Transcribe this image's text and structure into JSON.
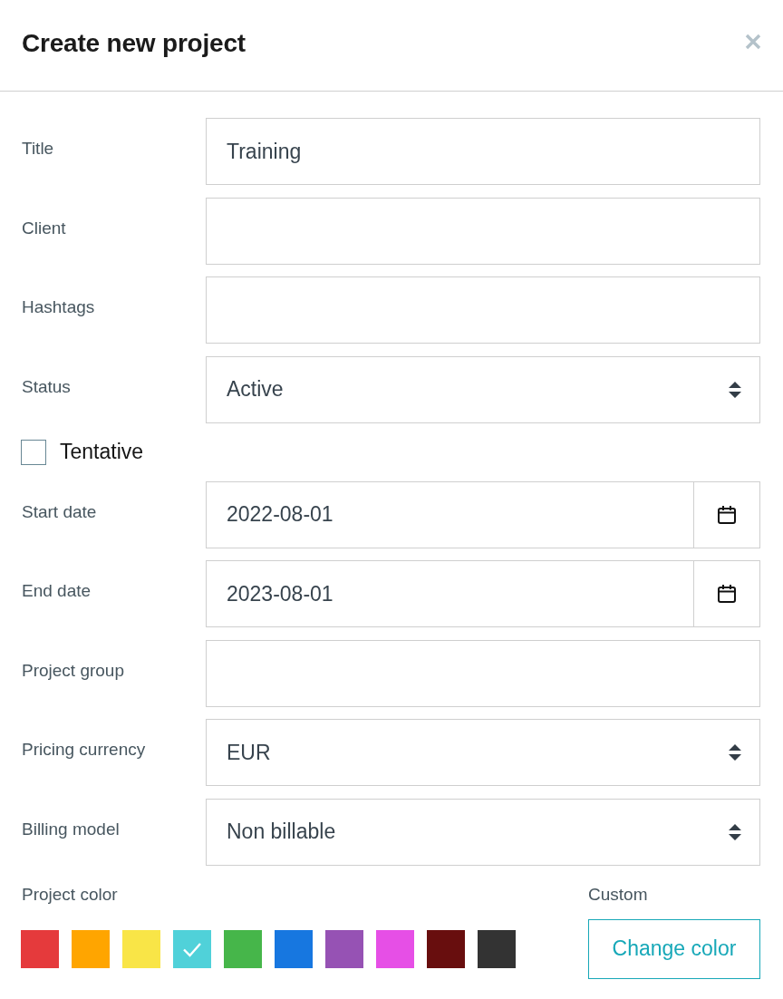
{
  "dialog": {
    "title": "Create new project"
  },
  "fields": [
    {
      "kind": "text",
      "label": "Title",
      "value": "Training"
    },
    {
      "kind": "text",
      "label": "Client"
    },
    {
      "kind": "text",
      "label": "Hashtags"
    },
    {
      "kind": "select",
      "label": "Status",
      "value": "Active"
    },
    {
      "kind": "checkbox",
      "label": "Tentative",
      "checked": false
    },
    {
      "kind": "date",
      "label": "Start date",
      "value": "2022-08-01"
    },
    {
      "kind": "date",
      "label": "End date",
      "value": "2023-08-01"
    },
    {
      "kind": "text",
      "label": "Project group"
    },
    {
      "kind": "select",
      "label": "Pricing currency",
      "value": "EUR"
    },
    {
      "kind": "select",
      "label": "Billing model",
      "value": "Non billable"
    }
  ],
  "project_color": {
    "label": "Project color",
    "swatches": [
      {
        "color": "#e53a3c",
        "selected": false
      },
      {
        "color": "#ffa500",
        "selected": false
      },
      {
        "color": "#f9e547",
        "selected": false
      },
      {
        "color": "#50d1d9",
        "selected": true
      },
      {
        "color": "#46b64a",
        "selected": false
      },
      {
        "color": "#1777e0",
        "selected": false
      },
      {
        "color": "#9652b4",
        "selected": false
      },
      {
        "color": "#e64fe6",
        "selected": false
      },
      {
        "color": "#680e0e",
        "selected": false
      },
      {
        "color": "#333333",
        "selected": false
      }
    ],
    "custom_label": "Custom",
    "change_button": "Change color"
  }
}
